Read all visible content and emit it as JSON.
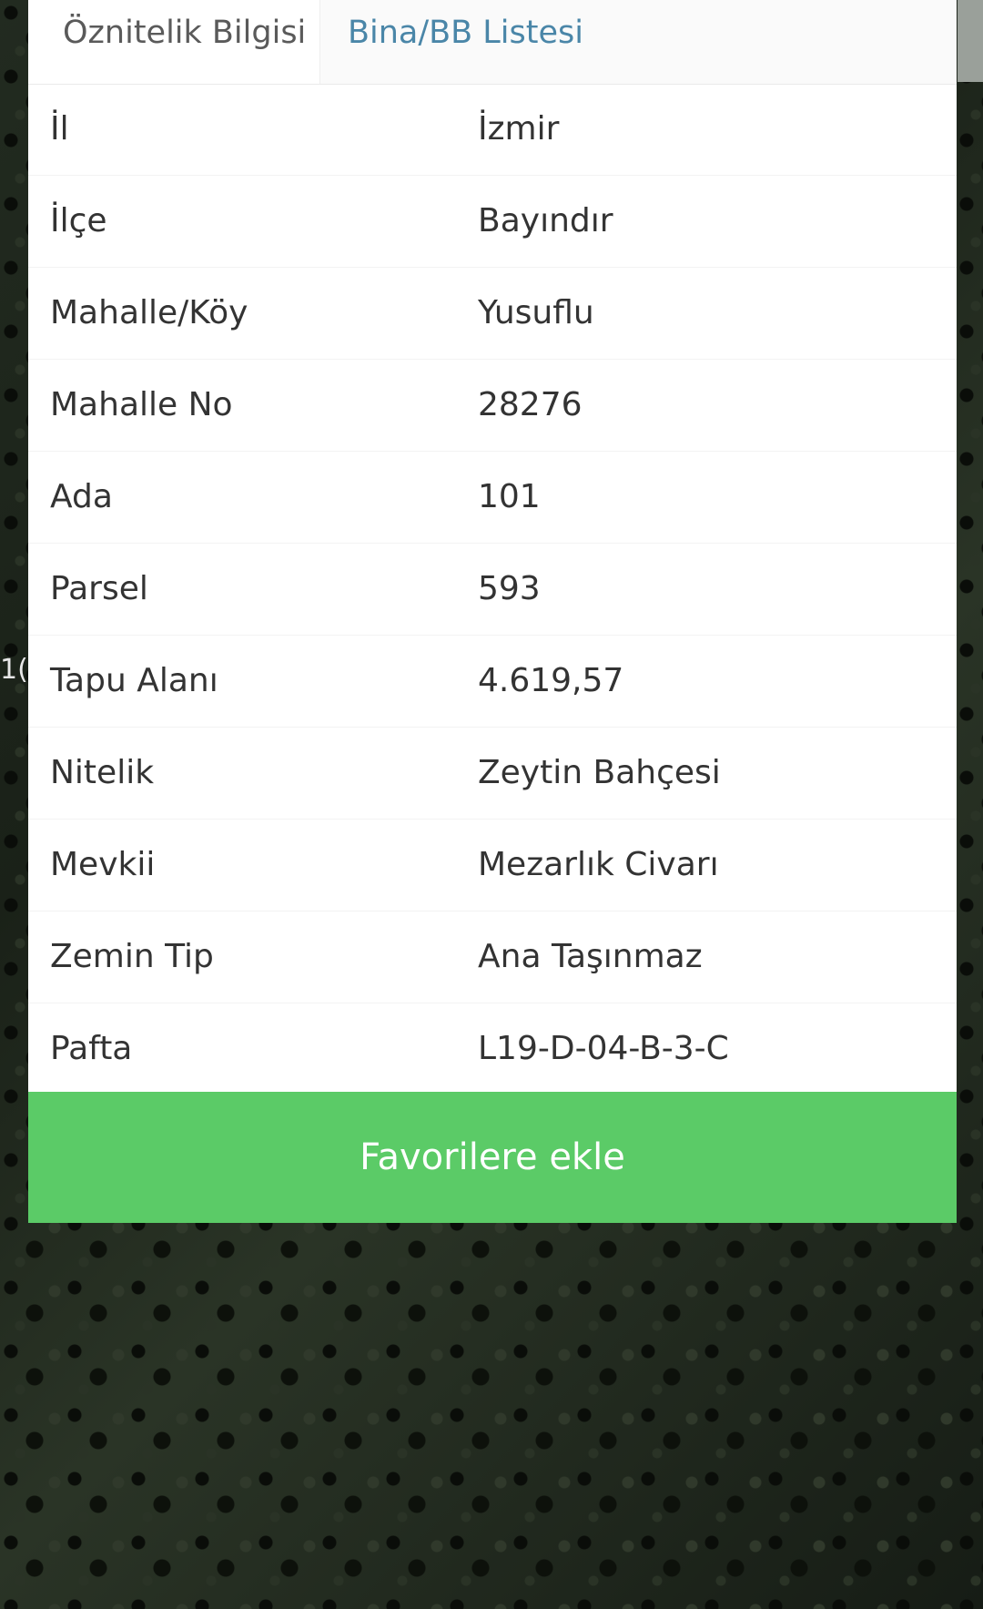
{
  "tabs": {
    "attribute_info": "Öznitelik Bilgisi",
    "building_list": "Bina/BB Listesi"
  },
  "attributes": [
    {
      "label": "İl",
      "value": "İzmir"
    },
    {
      "label": "İlçe",
      "value": "Bayındır"
    },
    {
      "label": "Mahalle/Köy",
      "value": "Yusuflu"
    },
    {
      "label": "Mahalle No",
      "value": "28276"
    },
    {
      "label": "Ada",
      "value": "101"
    },
    {
      "label": "Parsel",
      "value": "593"
    },
    {
      "label": "Tapu Alanı",
      "value": "4.619,57"
    },
    {
      "label": "Nitelik",
      "value": "Zeytin Bahçesi"
    },
    {
      "label": "Mevkii",
      "value": "Mezarlık Civarı"
    },
    {
      "label": "Zemin Tip",
      "value": "Ana Taşınmaz"
    },
    {
      "label": "Pafta",
      "value": "L19-D-04-B-3-C"
    }
  ],
  "favorite_button": "Favorilere ekle",
  "map": {
    "partial_label": "1("
  },
  "colors": {
    "accent_green": "#5bcb67",
    "tab_active_blue": "#4a86a8"
  }
}
